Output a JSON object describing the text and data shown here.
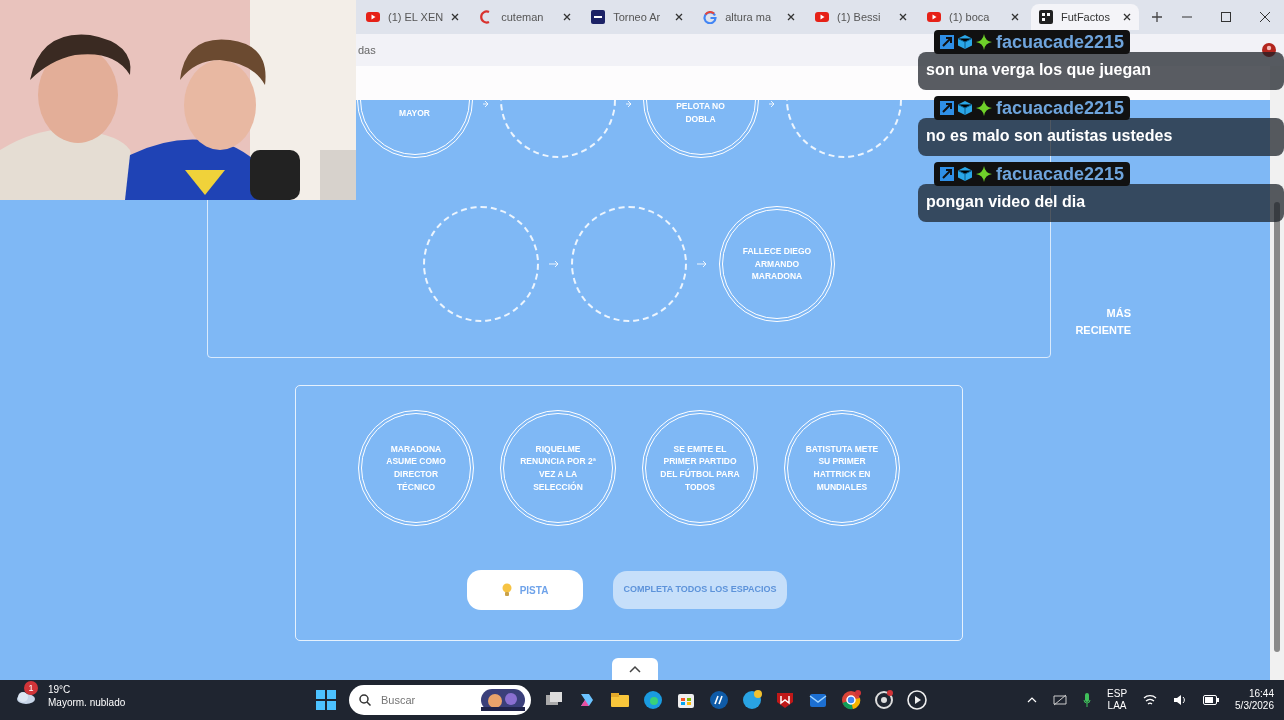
{
  "browser": {
    "tabs": [
      {
        "title": "(1) EL XEN",
        "selected": false
      },
      {
        "title": "cuteman",
        "selected": false
      },
      {
        "title": "Torneo Ar",
        "selected": false
      },
      {
        "title": "altura ma",
        "selected": false
      },
      {
        "title": "(1) Bessi",
        "selected": false
      },
      {
        "title": "(1) boca",
        "selected": false
      },
      {
        "title": "FutFactos",
        "selected": true
      }
    ],
    "address_text": "das"
  },
  "timeline": {
    "rows": [
      [
        {
          "kind": "event",
          "text": "MAYOR"
        },
        {
          "kind": "empty"
        },
        {
          "kind": "event",
          "text": "PELOTA NO DOBLA"
        },
        {
          "kind": "empty"
        }
      ],
      [
        {
          "kind": "empty"
        },
        {
          "kind": "empty"
        },
        {
          "kind": "event",
          "text": "FALLECE DIEGO ARMANDO MARADONA"
        }
      ]
    ],
    "end_label": "MÁS RECIENTE"
  },
  "cards": [
    {
      "text": "MARADONA ASUME COMO DIRECTOR TÉCNICO"
    },
    {
      "text": "RIQUELME RENUNCIA POR 2ª VEZ A LA SELECCIÓN"
    },
    {
      "text": "SE EMITE EL PRIMER PARTIDO DEL FÚTBOL PARA TODOS"
    },
    {
      "text": "BATISTUTA METE SU PRIMER HATTRICK EN MUNDIALES"
    }
  ],
  "buttons": {
    "hint": "PISTA",
    "submit": {
      "label": "COMPLETA TODOS LOS ESPACIOS",
      "disabled": true
    }
  },
  "chat": [
    {
      "user": "facuacade2215",
      "message": "son una verga los que juegan"
    },
    {
      "user": "facuacade2215",
      "message": "no es malo son autistas ustedes"
    },
    {
      "user": "facuacade2215",
      "message": "pongan video del dia"
    }
  ],
  "taskbar": {
    "weather_badge": "1",
    "temperature": "19°C",
    "weather": "Mayorm. nublado",
    "search_placeholder": "Buscar",
    "language": "ESP",
    "layout": "LAA",
    "time": "16:44",
    "date": "5/3/2026"
  }
}
